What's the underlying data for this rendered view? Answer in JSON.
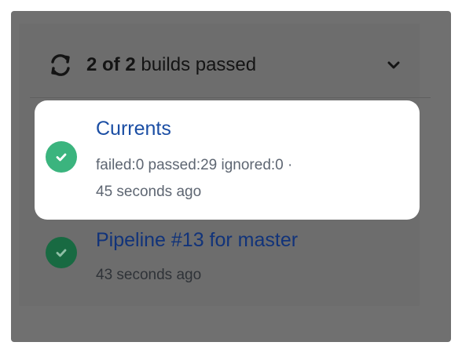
{
  "header": {
    "count_text": "2 of 2",
    "suffix_text": "builds passed",
    "icon": "refresh-icon",
    "toggle_icon": "chevron-down-icon"
  },
  "builds": [
    {
      "title": "Currents",
      "stats": "failed:0 passed:29 ignored:0 ·",
      "time": "45 seconds ago",
      "status": "passed",
      "status_color": "#3bb47e",
      "highlighted": true
    },
    {
      "title": "Pipeline #13 for master",
      "time": "43 seconds ago",
      "status": "passed",
      "status_color": "#186a42",
      "highlighted": false
    }
  ],
  "colors": {
    "link": "#1b4ea4",
    "overlay": "#707070",
    "success": "#3bb47e"
  }
}
